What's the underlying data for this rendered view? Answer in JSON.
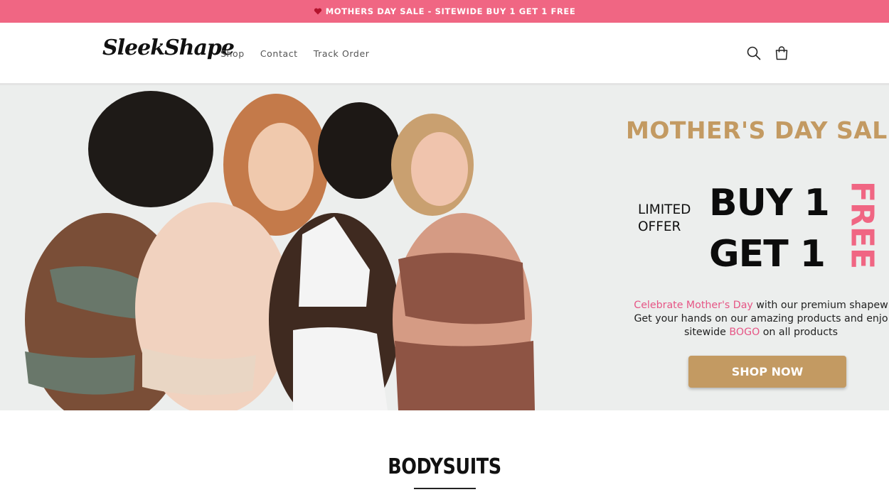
{
  "announcement": {
    "text": "MOTHERS DAY SALE - SITEWIDE BUY 1 GET 1 FREE",
    "icon": "heart-icon"
  },
  "header": {
    "logo": "SleekShape",
    "nav": [
      "Shop",
      "Contact",
      "Track Order"
    ],
    "icons": [
      "search-icon",
      "cart-icon"
    ]
  },
  "hero": {
    "title": "MOTHER'S DAY SAL",
    "limited_line1": "LIMITED",
    "limited_line2": "OFFER",
    "buy_line": "BUY 1",
    "get_line": "GET 1",
    "free_label": "FREE",
    "desc_pink": "Celebrate Mother's Day",
    "desc_line1_rest": " with our premium shapew",
    "desc_line2": "Get your hands on our amazing products and enjo",
    "desc_line3_start": "sitewide ",
    "desc_bogo": "BOGO",
    "desc_line3_end": " on all products",
    "cta": "SHOP NOW"
  },
  "section": {
    "title": "BODYSUITS"
  },
  "colors": {
    "announce_bg": "#f06683",
    "accent_gold": "#c39a62",
    "pink_text": "#e65585",
    "hero_bg": "#eceeed"
  }
}
